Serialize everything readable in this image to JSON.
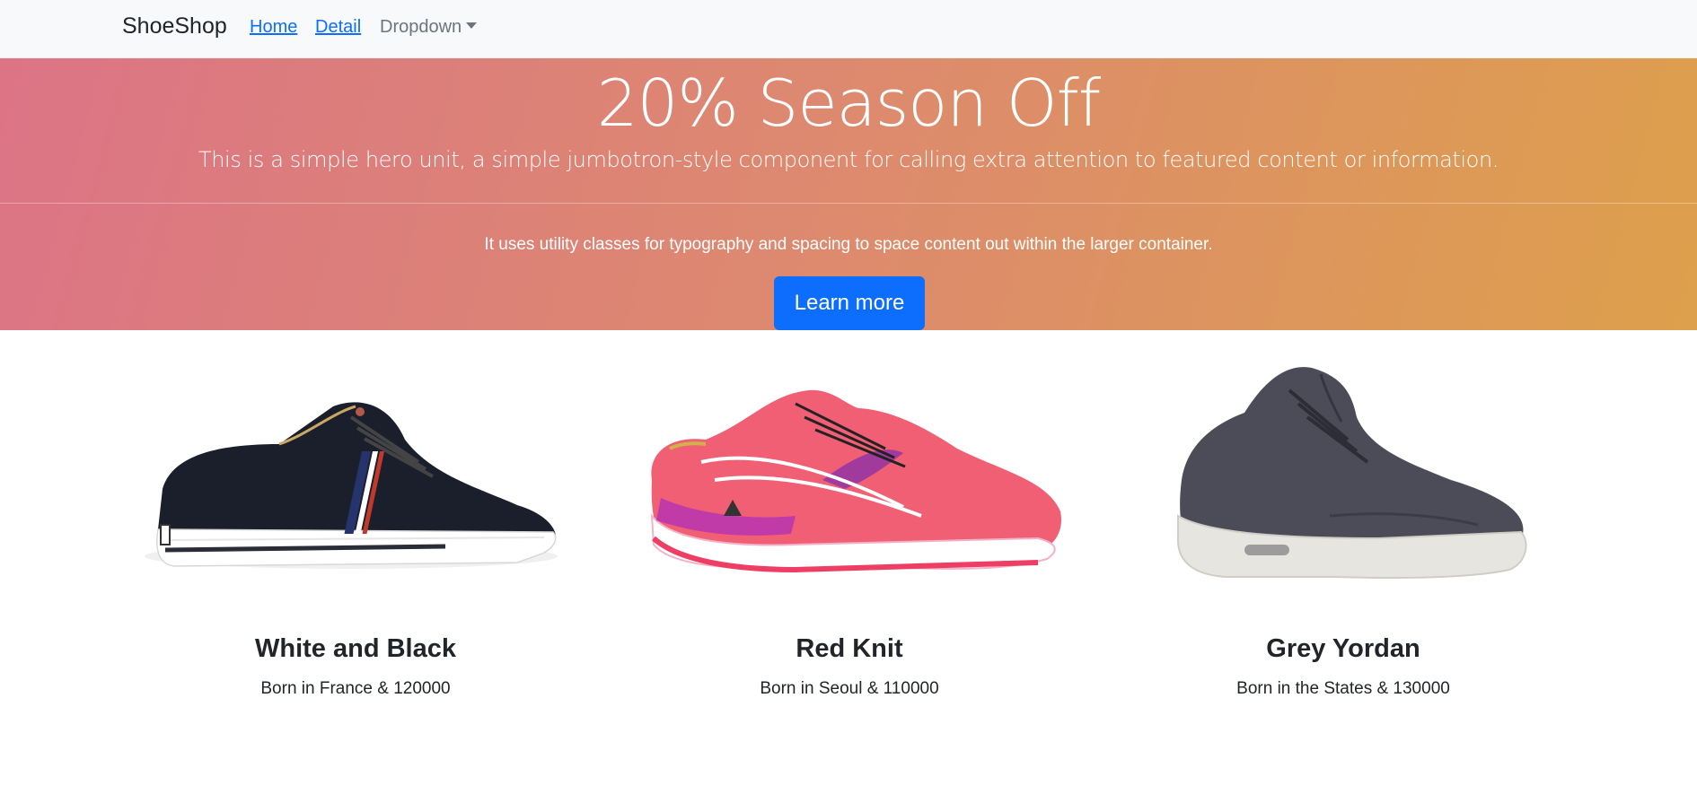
{
  "navbar": {
    "brand": "ShoeShop",
    "links": [
      {
        "label": "Home"
      },
      {
        "label": "Detail"
      }
    ],
    "dropdown_label": "Dropdown"
  },
  "hero": {
    "title": "20% Season Off",
    "lead": "This is a simple hero unit, a simple jumbotron-style component for calling extra attention to featured content or information.",
    "text": "It uses utility classes for typography and spacing to space content out within the larger container.",
    "button_label": "Learn more",
    "gradient_colors": [
      "#dc7486",
      "#dda04c"
    ],
    "button_color": "#0d6efd"
  },
  "products": [
    {
      "title": "White and Black",
      "subtitle": "Born in France & 120000",
      "image": "black-sneaker-image"
    },
    {
      "title": "Red Knit",
      "subtitle": "Born in Seoul & 110000",
      "image": "pink-running-shoe-image"
    },
    {
      "title": "Grey Yordan",
      "subtitle": "Born in the States & 130000",
      "image": "grey-high-top-sneaker-image"
    }
  ]
}
